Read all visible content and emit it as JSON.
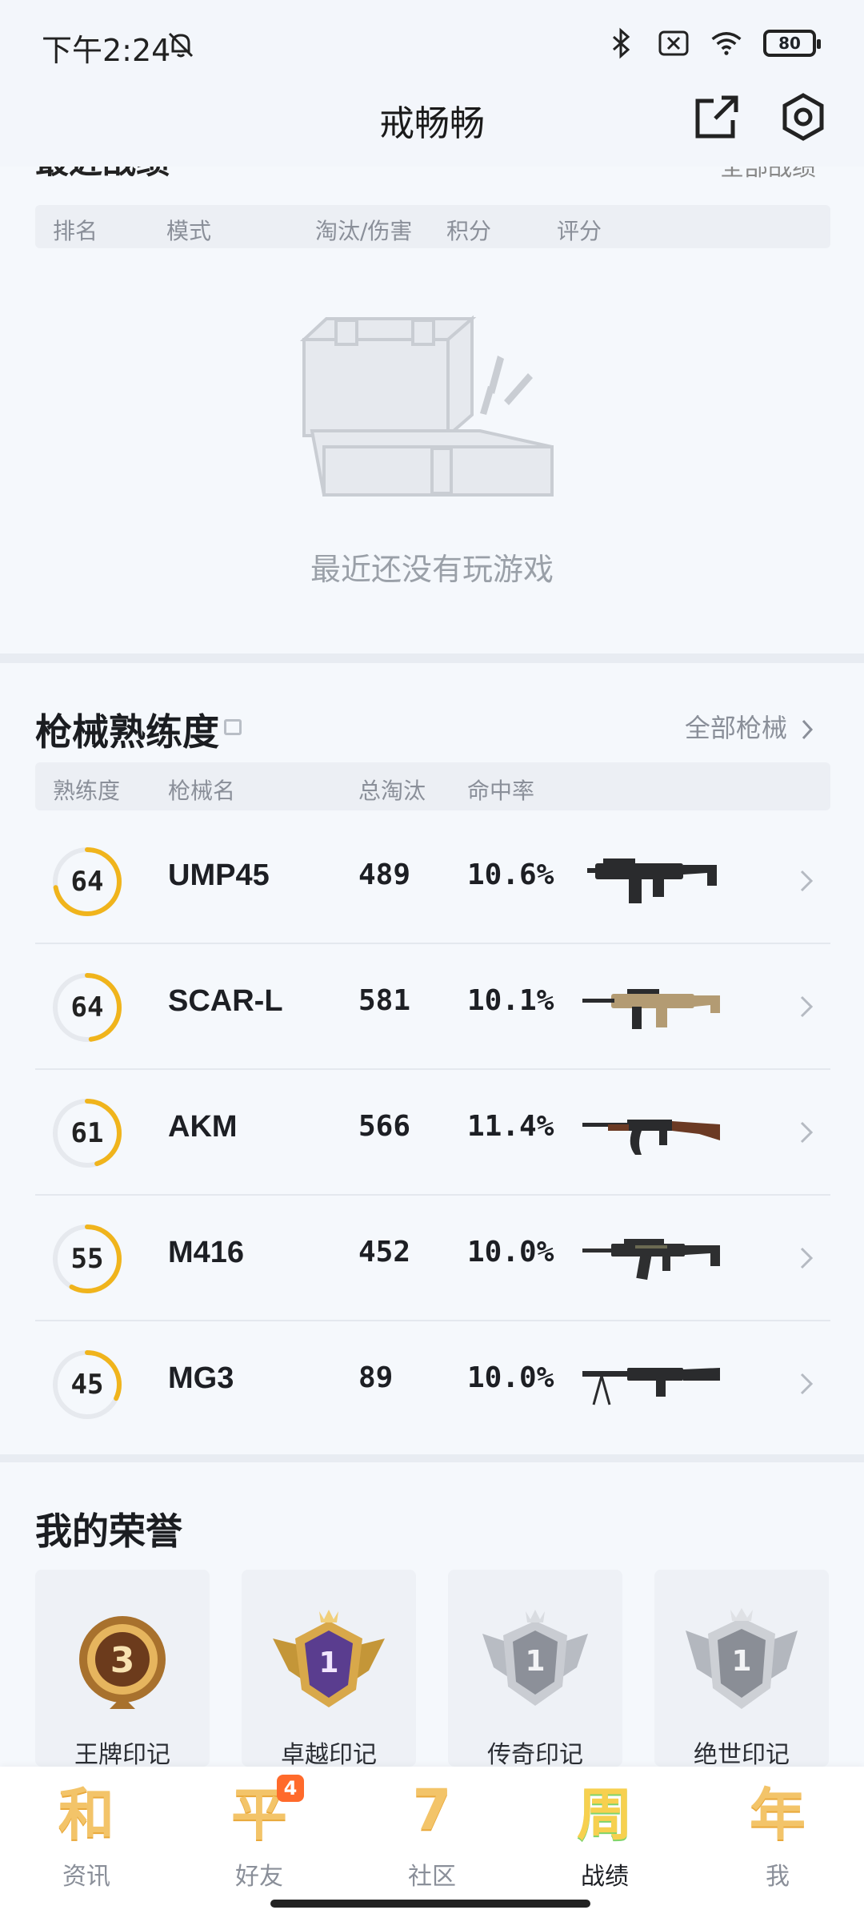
{
  "status_bar": {
    "time": "下午2:24",
    "battery": "80"
  },
  "header": {
    "title": "戒畅畅"
  },
  "recent": {
    "title": "最近战绩",
    "right_link": "全部战绩",
    "columns": [
      "排名",
      "模式",
      "淘汰/伤害",
      "积分",
      "评分"
    ],
    "empty_text": "最近还没有玩游戏"
  },
  "weapons": {
    "title": "枪械熟练度",
    "all_link": "全部枪械",
    "columns": [
      "熟练度",
      "枪械名",
      "总淘汰",
      "命中率"
    ],
    "rows": [
      {
        "level": "64",
        "name": "UMP45",
        "kills": "489",
        "accuracy": "10.6%",
        "progress": 0.72
      },
      {
        "level": "64",
        "name": "SCAR-L",
        "kills": "581",
        "accuracy": "10.1%",
        "progress": 0.48
      },
      {
        "level": "61",
        "name": "AKM",
        "kills": "566",
        "accuracy": "11.4%",
        "progress": 0.45
      },
      {
        "level": "55",
        "name": "M416",
        "kills": "452",
        "accuracy": "10.0%",
        "progress": 0.58
      },
      {
        "level": "45",
        "name": "MG3",
        "kills": "89",
        "accuracy": "10.0%",
        "progress": 0.32
      }
    ]
  },
  "honors": {
    "title": "我的荣誉",
    "items": [
      {
        "label": "王牌印记",
        "badge": "3",
        "tier": "gold"
      },
      {
        "label": "卓越印记",
        "badge": "1",
        "tier": "purple"
      },
      {
        "label": "传奇印记",
        "badge": "1",
        "tier": "silver"
      },
      {
        "label": "绝世印记",
        "badge": "1",
        "tier": "silver"
      }
    ]
  },
  "nav": {
    "items": [
      {
        "label": "资讯",
        "glyph": "和"
      },
      {
        "label": "好友",
        "glyph": "平",
        "badge": "4"
      },
      {
        "label": "社区",
        "glyph": "7"
      },
      {
        "label": "战绩",
        "glyph": "周"
      },
      {
        "label": "我",
        "glyph": "年"
      }
    ],
    "active_index": 3
  },
  "colors": {
    "accent": "#f0b41c",
    "ring_track": "#e6e9ee",
    "background": "#f5f8fc"
  }
}
